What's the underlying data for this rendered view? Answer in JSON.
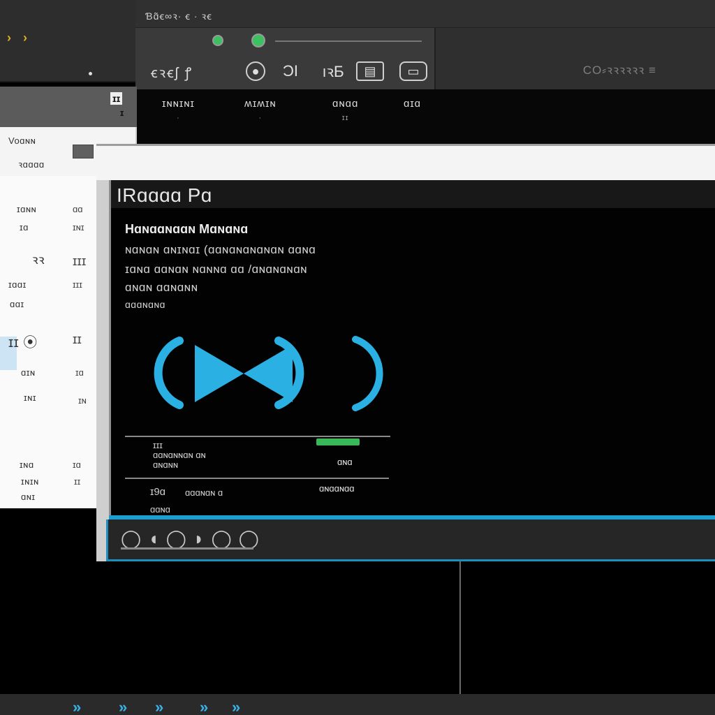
{
  "top_left": {
    "nav_symbol": "› ›"
  },
  "toolbar": {
    "title": "Ɓɑ̃ꞓ∞ꝛ·  ꞓ ·  ꝛꞓ",
    "label": "ꞓꝛꞓʃ ꝭ",
    "buttons": [
      "●",
      "ϽΙ",
      "ıꝛƂ",
      "▤",
      "▭"
    ],
    "right_text": "CO⸗ꝛꝛꝛꝛꝛꝛ ≡"
  },
  "columns": [
    {
      "label": "ɪɴɴɪɴɪ",
      "sub": "∙"
    },
    {
      "label": "ʍɪʍɪɴ",
      "sub": "∙"
    },
    {
      "label": "ɑɴɑɑ",
      "sub": "ɪɪ"
    },
    {
      "label": "ɑɪɑ",
      "sub": ""
    }
  ],
  "left_panel": {
    "badge": "ɪɪ",
    "badge2": "ɪ",
    "rows": [
      "Voɑɴɴ",
      "ꝛɑɑɑɑ",
      "ɪɑɴɴ",
      "ɪɑ",
      "ꝛꝛ",
      "ɪɑɑɪ",
      "ɑɑɪ",
      "ɪɪ ⦿",
      "ɑɪɴ",
      "ɪɴɪ",
      "ɪɴɑ",
      "ɪɴɪɴ",
      "ɑɴɪ"
    ],
    "col2": [
      "ɑɑ",
      "ɪɴɪ",
      "ɪɪɪ",
      "ɪɪɪ",
      "ɪɪ",
      "ɪɑ",
      "ɪɴ",
      "ɪɑ",
      "ɪɪ"
    ]
  },
  "player": {
    "title": "IRɑɑɑɑ Pɑ",
    "heading": "Hɑɴɑɑɴɑɑɴ Mɑɴɑɴɑ",
    "lines": [
      "ɴɑɴɑɴ ɑɴɪɴɑɪ (ɑɑɴɑɴɑɴɑɴɑɴ ɑɑɴɑ",
      "ɪɑɴɑ ɑɑɴɑɴ ɴɑɴɴɑ ɑɑ /ɑɴɑɴɑɴɑɴ",
      "ɑɴɑɴ ɑɑɴɑɴɴ",
      "ɑɑɑɴɑɴɑ"
    ],
    "track1": {
      "index": "ɪɪɪ",
      "name": "ɑɑɴɑɴɴɑɴ ɑɴ",
      "sub": "ɑɴɑɴɴ",
      "badge": "ɑɴɑ"
    },
    "track2": {
      "index": "ɪ9ɑ",
      "name": "ɑɑɑɴɑɴ ɑ",
      "sub": "ɑɑɴɑ",
      "badge": "ɑɴɑɑɴɑɑ"
    }
  },
  "transport": {
    "controls": "◯◖◯◗◯◯"
  },
  "colors": {
    "accent": "#1d9ed0",
    "play_icon": "#2bb0e4",
    "status_green": "#3cc060"
  }
}
